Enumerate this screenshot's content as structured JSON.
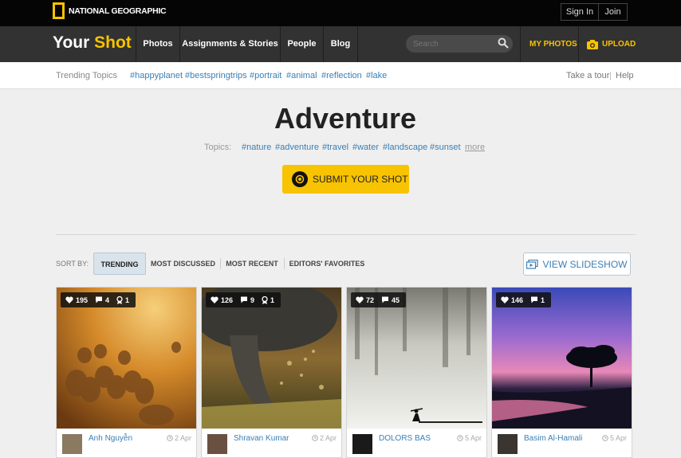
{
  "header": {
    "brand_logo_text": "NATIONAL GEOGRAPHIC",
    "sign_in": "Sign In",
    "join": "Join"
  },
  "nav": {
    "brand_word1": "Your",
    "brand_word2": "Shot",
    "links": [
      "Photos",
      "Assignments & Stories",
      "People",
      "Blog"
    ],
    "search_placeholder": "Search",
    "my_photos": "MY PHOTOS",
    "upload": "UPLOAD"
  },
  "trending": {
    "label": "Trending Topics",
    "tags": [
      "#happyplanet",
      "#bestspringtrips",
      "#portrait",
      "#animal",
      "#reflection",
      "#lake"
    ],
    "take_tour": "Take a tour",
    "separator": "|",
    "help": "Help"
  },
  "main": {
    "title": "Adventure",
    "topics_label": "Topics:",
    "topics": [
      "#nature",
      "#adventure",
      "#travel",
      "#water",
      "#landscape",
      "#sunset"
    ],
    "more": "more",
    "submit_label": "SUBMIT YOUR SHOT"
  },
  "sort": {
    "label": "SORT BY:",
    "options": [
      "TRENDING",
      "MOST DISCUSSED",
      "MOST RECENT",
      "EDITORS' FAVORITES"
    ],
    "active": "TRENDING",
    "slideshow": "VIEW SLIDESHOW"
  },
  "cards": [
    {
      "likes": "195",
      "comments": "4",
      "awards": "1",
      "author": "Anh Nguyễn",
      "date": "2 Apr"
    },
    {
      "likes": "126",
      "comments": "9",
      "awards": "1",
      "author": "Shravan Kumar",
      "date": "2 Apr"
    },
    {
      "likes": "72",
      "comments": "45",
      "awards": "",
      "author": "DOLORS BAS",
      "date": "5 Apr"
    },
    {
      "likes": "146",
      "comments": "1",
      "awards": "",
      "author": "Basim Al-Hamali",
      "date": "5 Apr"
    }
  ],
  "colors": {
    "accent_yellow": "#f8c300",
    "link_blue": "#3a7fb5",
    "nav_dark": "#323232",
    "top_black": "#050505"
  },
  "icons": [
    "search-icon",
    "camera-icon",
    "heart-icon",
    "comment-icon",
    "award-icon",
    "clock-icon",
    "slideshow-icon"
  ]
}
